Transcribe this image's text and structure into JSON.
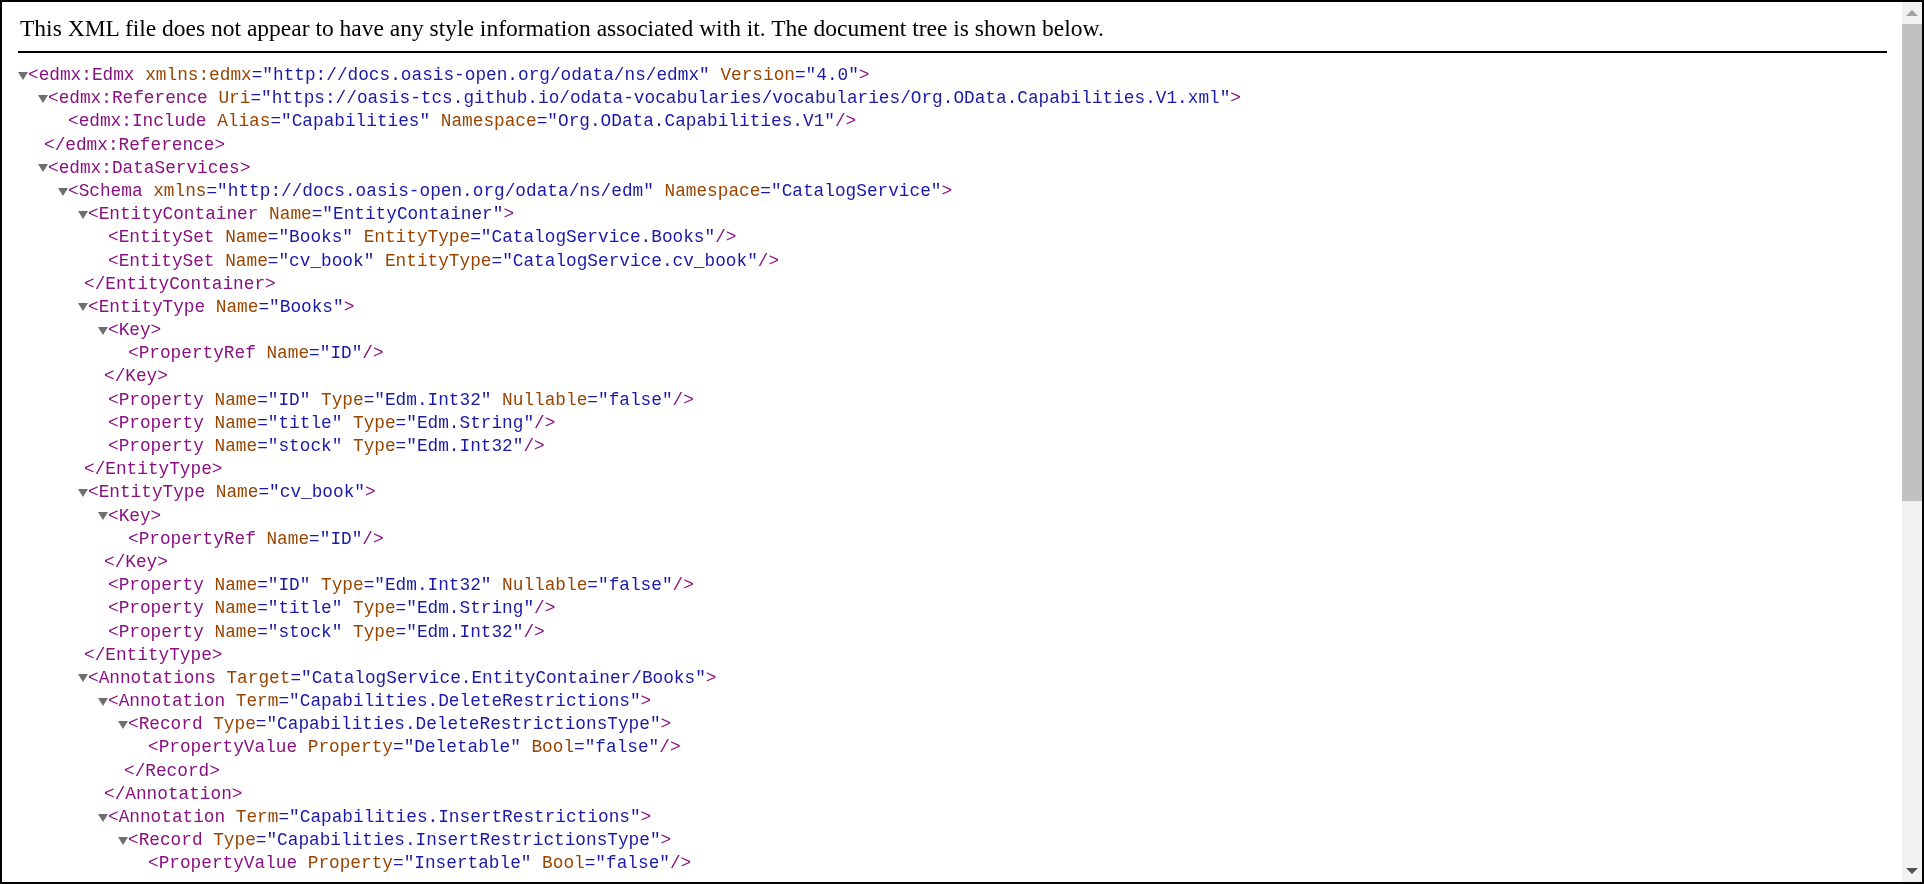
{
  "notice": "This XML file does not appear to have any style information associated with it. The document tree is shown below.",
  "tree": [
    {
      "kind": "element",
      "tag": "<edmx:Edmx",
      "attributes": [
        {
          "name": "xmlns:edmx",
          "value": "=\"http://docs.oasis-open.org/odata/ns/edmx\""
        },
        {
          "name": "Version",
          "value": "=\"4.0\""
        }
      ],
      "end": ">",
      "expanded": true,
      "children": [
        {
          "kind": "element",
          "tag": "<edmx:Reference",
          "attributes": [
            {
              "name": "Uri",
              "value": "=\"https://oasis-tcs.github.io/odata-vocabularies/vocabularies/Org.OData.Capabilities.V1.xml\""
            }
          ],
          "end": ">",
          "expanded": true,
          "close": "</edmx:Reference>",
          "children": [
            {
              "kind": "empty",
              "tag": "<edmx:Include",
              "attributes": [
                {
                  "name": "Alias",
                  "value": "=\"Capabilities\""
                },
                {
                  "name": "Namespace",
                  "value": "=\"Org.OData.Capabilities.V1\""
                }
              ],
              "end": "/>"
            }
          ]
        },
        {
          "kind": "element",
          "tag": "<edmx:DataServices",
          "end": ">",
          "expanded": true,
          "children": [
            {
              "kind": "element",
              "tag": "<Schema",
              "attributes": [
                {
                  "name": "xmlns",
                  "value": "=\"http://docs.oasis-open.org/odata/ns/edm\""
                },
                {
                  "name": "Namespace",
                  "value": "=\"CatalogService\""
                }
              ],
              "end": ">",
              "expanded": true,
              "children": [
                {
                  "kind": "element",
                  "tag": "<EntityContainer",
                  "attributes": [
                    {
                      "name": "Name",
                      "value": "=\"EntityContainer\""
                    }
                  ],
                  "end": ">",
                  "expanded": true,
                  "close": "</EntityContainer>",
                  "children": [
                    {
                      "kind": "empty",
                      "tag": "<EntitySet",
                      "attributes": [
                        {
                          "name": "Name",
                          "value": "=\"Books\""
                        },
                        {
                          "name": "EntityType",
                          "value": "=\"CatalogService.Books\""
                        }
                      ],
                      "end": "/>"
                    },
                    {
                      "kind": "empty",
                      "tag": "<EntitySet",
                      "attributes": [
                        {
                          "name": "Name",
                          "value": "=\"cv_book\""
                        },
                        {
                          "name": "EntityType",
                          "value": "=\"CatalogService.cv_book\""
                        }
                      ],
                      "end": "/>"
                    }
                  ]
                },
                {
                  "kind": "element",
                  "tag": "<EntityType",
                  "attributes": [
                    {
                      "name": "Name",
                      "value": "=\"Books\""
                    }
                  ],
                  "end": ">",
                  "expanded": true,
                  "close": "</EntityType>",
                  "children": [
                    {
                      "kind": "element",
                      "tag": "<Key",
                      "end": ">",
                      "expanded": true,
                      "close": "</Key>",
                      "children": [
                        {
                          "kind": "empty",
                          "tag": "<PropertyRef",
                          "attributes": [
                            {
                              "name": "Name",
                              "value": "=\"ID\""
                            }
                          ],
                          "end": "/>"
                        }
                      ]
                    },
                    {
                      "kind": "empty",
                      "tag": "<Property",
                      "attributes": [
                        {
                          "name": "Name",
                          "value": "=\"ID\""
                        },
                        {
                          "name": "Type",
                          "value": "=\"Edm.Int32\""
                        },
                        {
                          "name": "Nullable",
                          "value": "=\"false\""
                        }
                      ],
                      "end": "/>"
                    },
                    {
                      "kind": "empty",
                      "tag": "<Property",
                      "attributes": [
                        {
                          "name": "Name",
                          "value": "=\"title\""
                        },
                        {
                          "name": "Type",
                          "value": "=\"Edm.String\""
                        }
                      ],
                      "end": "/>"
                    },
                    {
                      "kind": "empty",
                      "tag": "<Property",
                      "attributes": [
                        {
                          "name": "Name",
                          "value": "=\"stock\""
                        },
                        {
                          "name": "Type",
                          "value": "=\"Edm.Int32\""
                        }
                      ],
                      "end": "/>"
                    }
                  ]
                },
                {
                  "kind": "element",
                  "tag": "<EntityType",
                  "attributes": [
                    {
                      "name": "Name",
                      "value": "=\"cv_book\""
                    }
                  ],
                  "end": ">",
                  "expanded": true,
                  "close": "</EntityType>",
                  "children": [
                    {
                      "kind": "element",
                      "tag": "<Key",
                      "end": ">",
                      "expanded": true,
                      "close": "</Key>",
                      "children": [
                        {
                          "kind": "empty",
                          "tag": "<PropertyRef",
                          "attributes": [
                            {
                              "name": "Name",
                              "value": "=\"ID\""
                            }
                          ],
                          "end": "/>"
                        }
                      ]
                    },
                    {
                      "kind": "empty",
                      "tag": "<Property",
                      "attributes": [
                        {
                          "name": "Name",
                          "value": "=\"ID\""
                        },
                        {
                          "name": "Type",
                          "value": "=\"Edm.Int32\""
                        },
                        {
                          "name": "Nullable",
                          "value": "=\"false\""
                        }
                      ],
                      "end": "/>"
                    },
                    {
                      "kind": "empty",
                      "tag": "<Property",
                      "attributes": [
                        {
                          "name": "Name",
                          "value": "=\"title\""
                        },
                        {
                          "name": "Type",
                          "value": "=\"Edm.String\""
                        }
                      ],
                      "end": "/>"
                    },
                    {
                      "kind": "empty",
                      "tag": "<Property",
                      "attributes": [
                        {
                          "name": "Name",
                          "value": "=\"stock\""
                        },
                        {
                          "name": "Type",
                          "value": "=\"Edm.Int32\""
                        }
                      ],
                      "end": "/>"
                    }
                  ]
                },
                {
                  "kind": "element",
                  "tag": "<Annotations",
                  "attributes": [
                    {
                      "name": "Target",
                      "value": "=\"CatalogService.EntityContainer/Books\""
                    }
                  ],
                  "end": ">",
                  "expanded": true,
                  "children": [
                    {
                      "kind": "element",
                      "tag": "<Annotation",
                      "attributes": [
                        {
                          "name": "Term",
                          "value": "=\"Capabilities.DeleteRestrictions\""
                        }
                      ],
                      "end": ">",
                      "expanded": true,
                      "close": "</Annotation>",
                      "children": [
                        {
                          "kind": "element",
                          "tag": "<Record",
                          "attributes": [
                            {
                              "name": "Type",
                              "value": "=\"Capabilities.DeleteRestrictionsType\""
                            }
                          ],
                          "end": ">",
                          "expanded": true,
                          "close": "</Record>",
                          "children": [
                            {
                              "kind": "empty",
                              "tag": "<PropertyValue",
                              "attributes": [
                                {
                                  "name": "Property",
                                  "value": "=\"Deletable\""
                                },
                                {
                                  "name": "Bool",
                                  "value": "=\"false\""
                                }
                              ],
                              "end": "/>"
                            }
                          ]
                        }
                      ]
                    },
                    {
                      "kind": "element",
                      "tag": "<Annotation",
                      "attributes": [
                        {
                          "name": "Term",
                          "value": "=\"Capabilities.InsertRestrictions\""
                        }
                      ],
                      "end": ">",
                      "expanded": true,
                      "children": [
                        {
                          "kind": "element",
                          "tag": "<Record",
                          "attributes": [
                            {
                              "name": "Type",
                              "value": "=\"Capabilities.InsertRestrictionsType\""
                            }
                          ],
                          "end": ">",
                          "expanded": true,
                          "children": [
                            {
                              "kind": "empty",
                              "tag": "<PropertyValue",
                              "attributes": [
                                {
                                  "name": "Property",
                                  "value": "=\"Insertable\""
                                },
                                {
                                  "name": "Bool",
                                  "value": "=\"false\""
                                }
                              ],
                              "end": "/>"
                            }
                          ]
                        }
                      ]
                    }
                  ]
                }
              ]
            }
          ]
        }
      ]
    }
  ]
}
